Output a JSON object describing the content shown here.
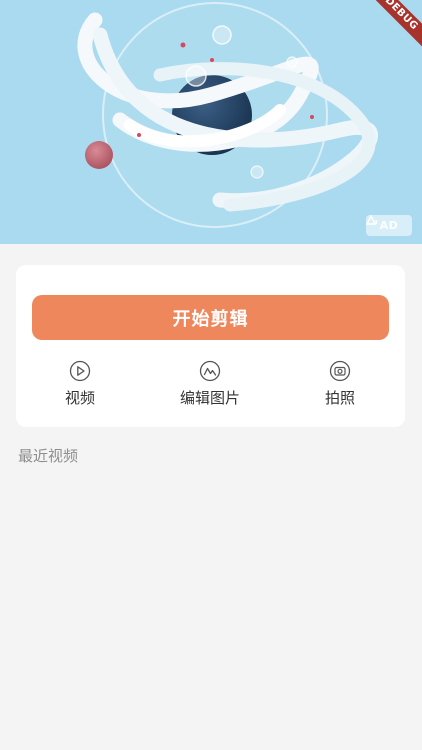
{
  "banner": {
    "ad_label": "AD",
    "debug_label": "DEBUG"
  },
  "card": {
    "start_button_label": "开始剪辑",
    "actions": [
      {
        "label": "视频",
        "icon": "play-circle-icon"
      },
      {
        "label": "编辑图片",
        "icon": "image-wave-icon"
      },
      {
        "label": "拍照",
        "icon": "camera-icon"
      }
    ]
  },
  "recent": {
    "title": "最近视频"
  },
  "colors": {
    "accent": "#ef875d",
    "background": "#f4f4f4",
    "card": "#ffffff",
    "banner_sky": "#a9daef",
    "debug_ribbon": "#a8332c"
  }
}
